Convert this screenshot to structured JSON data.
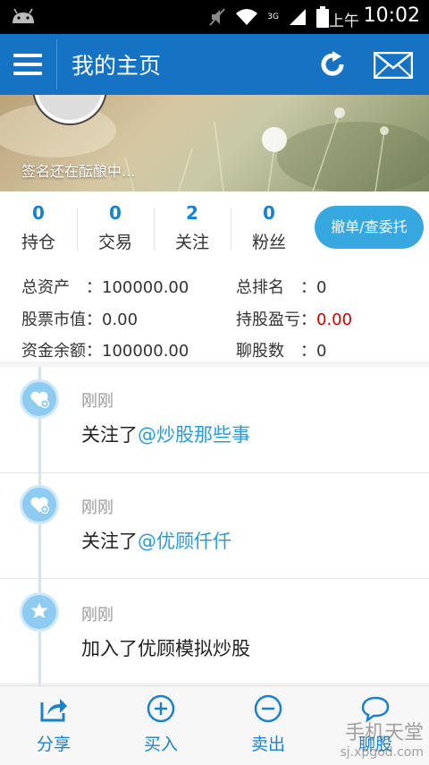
{
  "status_bar": {
    "ampm": "上午",
    "time": "10:02",
    "network_label": "3G"
  },
  "app_bar": {
    "title": "我的主页"
  },
  "banner": {
    "signature": "签名还在酝酿中..."
  },
  "stats": [
    {
      "value": "0",
      "label": "持仓"
    },
    {
      "value": "0",
      "label": "交易"
    },
    {
      "value": "2",
      "label": "关注"
    },
    {
      "value": "0",
      "label": "粉丝"
    }
  ],
  "cancel_button": "撤单/查委托",
  "account": {
    "total_assets_label": "总资产　：",
    "total_assets": "100000.00",
    "rank_label": "总排名　：",
    "rank": "0",
    "market_value_label": "股票市值：",
    "market_value": "0.00",
    "pnl_label": "持股盈亏：",
    "pnl": "0.00",
    "cash_label": "资金余额：",
    "cash": "100000.00",
    "chat_label": "聊股数　：",
    "chat": "0"
  },
  "feed": [
    {
      "time": "刚刚",
      "prefix": "关注了",
      "link": "@炒股那些事",
      "icon": "heart-plus-icon"
    },
    {
      "time": "刚刚",
      "prefix": "关注了",
      "link": "@优顾仟仟",
      "icon": "heart-plus-icon"
    },
    {
      "time": "刚刚",
      "prefix": "加入了优顾模拟炒股",
      "link": "",
      "icon": "star-icon"
    }
  ],
  "bottom_tabs": [
    {
      "label": "分享",
      "icon": "share-icon"
    },
    {
      "label": "买入",
      "icon": "plus-circle-icon"
    },
    {
      "label": "卖出",
      "icon": "minus-circle-icon"
    },
    {
      "label": "聊股",
      "icon": "chat-bubble-icon"
    }
  ],
  "watermark": {
    "title": "手机天堂",
    "url": "sj.xpgod.com"
  },
  "colors": {
    "primary": "#1673c4",
    "accent": "#36a8df",
    "link": "#2a9ad8",
    "loss": "#cc0000"
  }
}
